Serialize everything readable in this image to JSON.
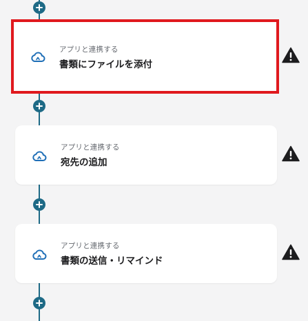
{
  "flow": {
    "steps": [
      {
        "kicker": "アプリと連携する",
        "title": "書類にファイルを添付",
        "icon": "cloud-sync-icon",
        "status_icon": "warning-icon",
        "selected": true
      },
      {
        "kicker": "アプリと連携する",
        "title": "宛先の追加",
        "icon": "cloud-sync-icon",
        "status_icon": "warning-icon",
        "selected": false
      },
      {
        "kicker": "アプリと連携する",
        "title": "書類の送信・リマインド",
        "icon": "cloud-sync-icon",
        "status_icon": "warning-icon",
        "selected": false
      }
    ],
    "add_step_icon": "plus-icon"
  },
  "colors": {
    "background": "#f4f4f5",
    "connector": "#1e6a86",
    "card": "#ffffff",
    "selected_outline": "#e0191e",
    "icon_accent": "#1f6fb7",
    "warning": "#1d1d1f"
  }
}
